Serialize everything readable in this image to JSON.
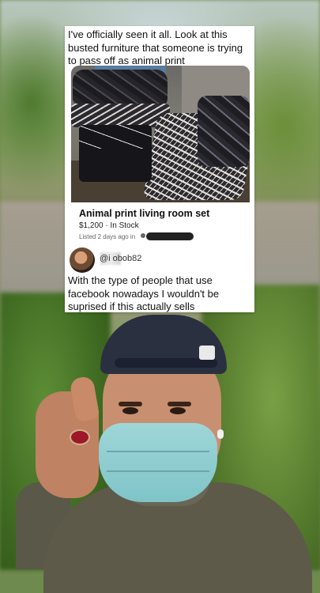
{
  "post": {
    "text": "I've officially seen it all. Look at this busted furniture that someone is trying to pass off as animal print"
  },
  "listing": {
    "title": "Animal print living room set",
    "price": "$1,200 · In Stock",
    "meta": "Listed 2 days ago in"
  },
  "comment": {
    "username": "@i    obob82",
    "text": "With the type of people that use facebook nowadays I wouldn't be suprised if this actually sells"
  },
  "colors": {
    "card_bg": "#ffffff",
    "redaction": "#222222"
  }
}
